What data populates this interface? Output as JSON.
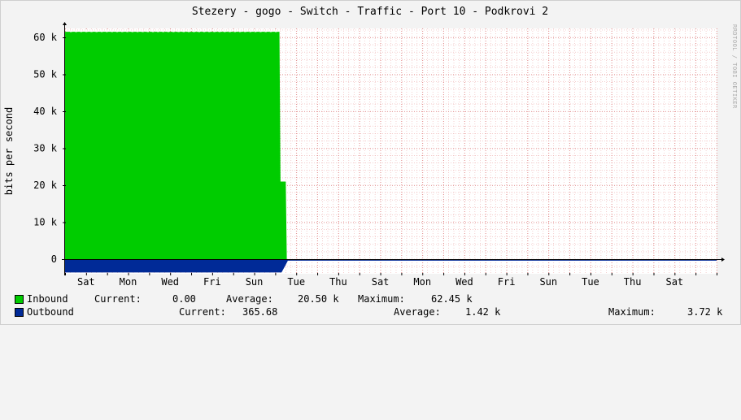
{
  "chart_data": {
    "type": "area",
    "title": "Stezery - gogo - Switch - Traffic - Port 10 - Podkrovi 2",
    "ylabel": "bits per second",
    "watermark": "RRDTOOL / TOBI OETIKER",
    "ylim": [
      -3000,
      63000
    ],
    "y_ticks": [
      {
        "value": 60000,
        "label": "60 k"
      },
      {
        "value": 50000,
        "label": "50 k"
      },
      {
        "value": 40000,
        "label": "40 k"
      },
      {
        "value": 30000,
        "label": "30 k"
      },
      {
        "value": 20000,
        "label": "20 k"
      },
      {
        "value": 10000,
        "label": "10 k"
      },
      {
        "value": 0,
        "label": "0"
      }
    ],
    "x_days": [
      "Sat",
      "Mon",
      "Wed",
      "Fri",
      "Sun",
      "Tue",
      "Thu",
      "Sat",
      "Mon",
      "Wed",
      "Fri",
      "Sun",
      "Tue",
      "Thu",
      "Sat"
    ],
    "xlim": [
      0,
      31
    ],
    "series": [
      {
        "name": "Inbound",
        "color": "#00cc00",
        "x": [
          0,
          10.2,
          10.25,
          10.5,
          10.55,
          31
        ],
        "values": [
          61500,
          61500,
          21000,
          21000,
          0,
          0
        ],
        "stats": {
          "current_label": "Current:",
          "current": "0.00",
          "average_label": "Average:",
          "average": "20.50 k",
          "maximum_label": "Maximum:",
          "maximum": "62.45 k"
        }
      },
      {
        "name": "Outbound",
        "color": "#002a97",
        "x": [
          0,
          10.3,
          10.5,
          10.6,
          31
        ],
        "values": [
          3600,
          3600,
          1500,
          400,
          400
        ],
        "stats": {
          "current_label": "Current:",
          "current": "365.68",
          "average_label": "Average:",
          "average": "1.42 k",
          "maximum_label": "Maximum:",
          "maximum": "3.72 k"
        }
      }
    ]
  }
}
